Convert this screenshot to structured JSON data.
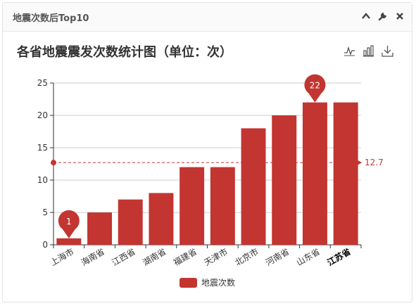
{
  "panel": {
    "title": "地震次数后Top10",
    "tools": [
      "chevron-up-icon",
      "wrench-icon",
      "close-icon"
    ]
  },
  "toolbox": [
    "line-chart-icon",
    "bar-chart-icon",
    "download-icon"
  ],
  "colors": {
    "bar": "#c23531",
    "axis": "#333333",
    "grid": "#cccccc"
  },
  "chart_data": {
    "type": "bar",
    "title": "各省地震震发次数统计图（单位：次）",
    "categories": [
      "上海市",
      "海南省",
      "江西省",
      "湖南省",
      "福建省",
      "天津市",
      "北京市",
      "河南省",
      "山东省",
      "江苏省"
    ],
    "series": [
      {
        "name": "地震次数",
        "values": [
          1,
          5,
          7,
          8,
          12,
          12,
          18,
          20,
          22,
          22
        ]
      }
    ],
    "ylim": [
      0,
      25
    ],
    "yticks": [
      0,
      5,
      10,
      15,
      20,
      25
    ],
    "mark_points": [
      {
        "label": "1",
        "index": 0
      },
      {
        "label": "22",
        "index": 8
      }
    ],
    "mark_line": {
      "label": "12.7",
      "value": 12.7
    },
    "grid": true,
    "legend": "bottom-center"
  }
}
